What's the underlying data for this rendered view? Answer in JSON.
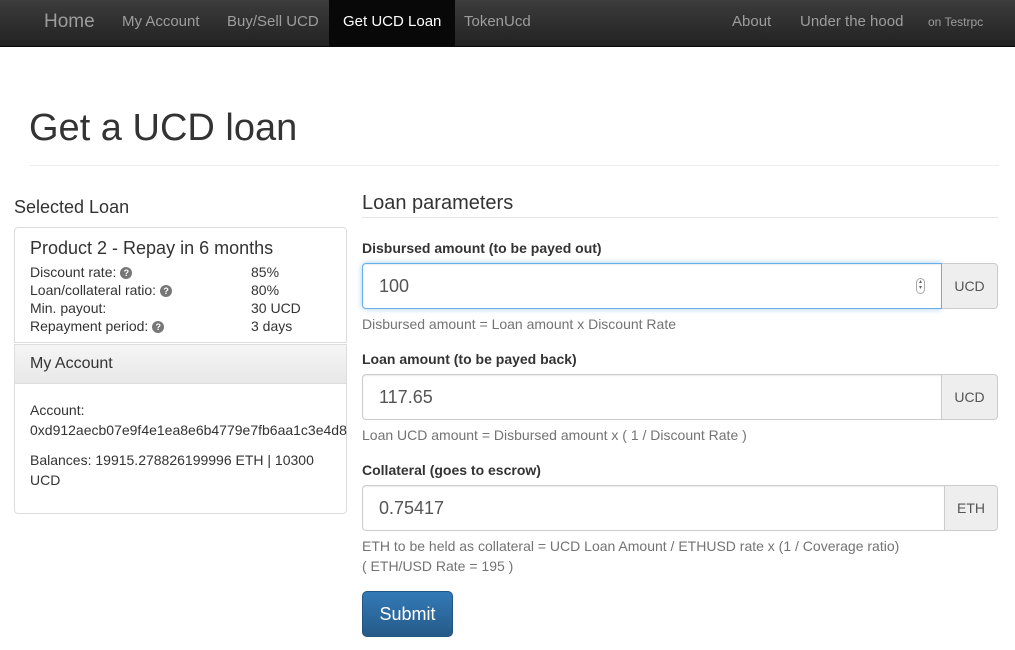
{
  "navbar": {
    "brand": "Home",
    "items": [
      "My Account",
      "Buy/Sell UCD",
      "Get UCD Loan",
      "TokenUcd"
    ],
    "right_items": [
      "About",
      "Under the hood"
    ],
    "network": "on Testrpc"
  },
  "page": {
    "title": "Get a UCD loan"
  },
  "selected_loan": {
    "heading": "Selected Loan",
    "product_title": "Product 2 - Repay in 6 months",
    "rows": [
      {
        "label": "Discount rate:",
        "value": "85%"
      },
      {
        "label": "Loan/collateral ratio:",
        "value": "80%"
      },
      {
        "label": "Min. payout:",
        "value": "30 UCD"
      },
      {
        "label": "Repayment period:",
        "value": "3 days"
      }
    ]
  },
  "my_account": {
    "heading": "My Account",
    "account_label": "Account:",
    "address": "0xd912aecb07e9f4e1ea8e6b4779e7fb6aa1c3e4d8",
    "balances": "Balances: 19915.278826199996 ETH | 10300 UCD"
  },
  "loan_params": {
    "heading": "Loan parameters",
    "disbursed": {
      "label": "Disbursed amount (to be payed out)",
      "value": "100",
      "unit": "UCD",
      "help": "Disbursed amount = Loan amount x Discount Rate"
    },
    "loan_amount": {
      "label": "Loan amount (to be payed back)",
      "value": "117.65",
      "unit": "UCD",
      "help": "Loan UCD amount = Disbursed amount x ( 1 / Discount Rate )"
    },
    "collateral": {
      "label": "Collateral (goes to escrow)",
      "value": "0.75417",
      "unit": "ETH",
      "help_line1": "ETH to be held as collateral = UCD Loan Amount / ETHUSD rate x (1 / Coverage ratio)",
      "help_line2": "( ETH/USD Rate = 195 )"
    },
    "submit_label": "Submit"
  },
  "icons": {
    "help": "question-circle-icon",
    "spinner": "number-spinner-icon"
  },
  "colors": {
    "navbar": "#222222",
    "active_nav": "#080808",
    "primary": "#337ab7",
    "focus": "#66afe9"
  }
}
